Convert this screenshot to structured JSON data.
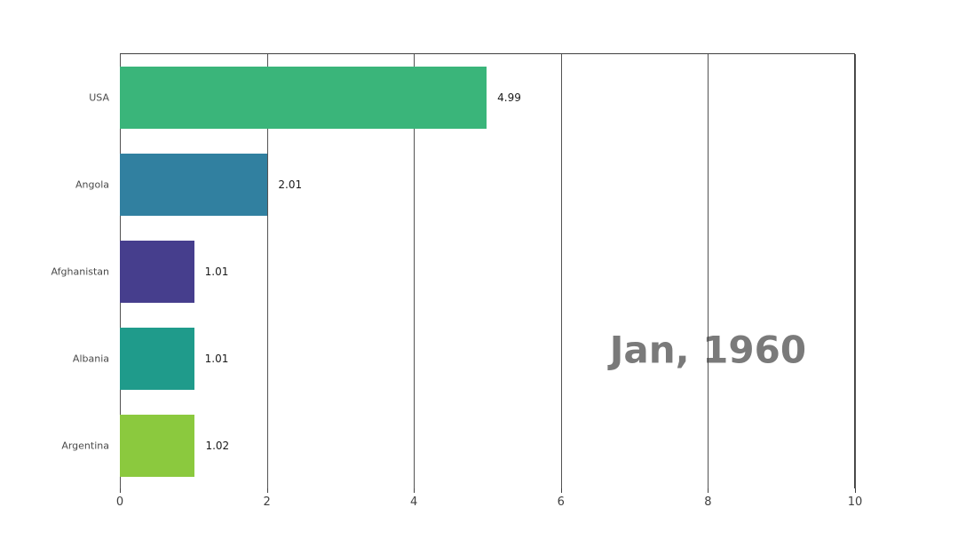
{
  "chart_data": {
    "type": "bar",
    "orientation": "horizontal",
    "categories": [
      "USA",
      "Angola",
      "Afghanistan",
      "Albania",
      "Argentina"
    ],
    "values": [
      4.99,
      2.01,
      1.01,
      1.01,
      1.02
    ],
    "colors": [
      "#3ab57a",
      "#3180a0",
      "#463e8d",
      "#1f9b8b",
      "#8bc93e"
    ],
    "xlim": [
      0,
      10
    ],
    "x_ticks": [
      0,
      2,
      4,
      6,
      8,
      10
    ],
    "title": "",
    "xlabel": "",
    "ylabel": "",
    "period_label": "Jan, 1960"
  }
}
